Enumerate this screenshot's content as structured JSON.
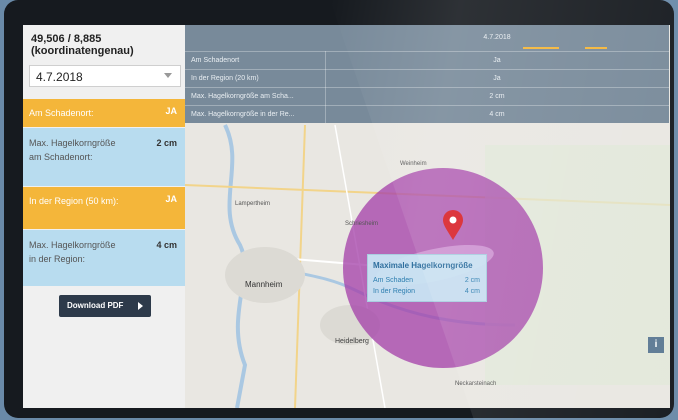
{
  "header": {
    "coords_line1": "49,506 / 8,885",
    "coords_line2": "(koordinatengenau)"
  },
  "date_select": {
    "value": "4.7.2018"
  },
  "summary": [
    {
      "label": "Am Schadenort:",
      "value": "JA",
      "color": "#f4b63a"
    },
    {
      "label": "Max. Hagelkorngröße am Schadenort:",
      "value": "2 cm",
      "color": "#b8dcef"
    },
    {
      "label": "In der Region (50 km):",
      "value": "JA",
      "color": "#f4b63a"
    },
    {
      "label": "Max. Hagelkorngröße in der Region:",
      "value": "4 cm",
      "color": "#b8dcef"
    }
  ],
  "download_button": {
    "label": "Download PDF"
  },
  "table": {
    "column": "4.7.2018",
    "rows": [
      {
        "key": "Am Schadenort",
        "value": "Ja"
      },
      {
        "key": "In der Region (20 km)",
        "value": "Ja"
      },
      {
        "key": "Max. Hagelkorngröße am Scha...",
        "value": "2 cm"
      },
      {
        "key": "Max. Hagelkorngröße in der Re...",
        "value": "4 cm"
      }
    ]
  },
  "popup": {
    "title": "Maximale Hagelkorngröße",
    "rows": [
      {
        "label": "Am Schaden",
        "value": "2 cm"
      },
      {
        "label": "In der Region",
        "value": "4 cm"
      }
    ]
  },
  "map": {
    "labels": [
      "Mannheim",
      "Heidelberg",
      "Schriesheim",
      "Weinheim",
      "Lampertheim",
      "Neckarsteinach"
    ],
    "info_label": "i"
  },
  "colors": {
    "hail_area": "#a33ea8",
    "orange": "#f4b63a",
    "light_blue": "#b8dcef",
    "marker": "#d8232a",
    "button_dark": "#2d3a4a"
  }
}
